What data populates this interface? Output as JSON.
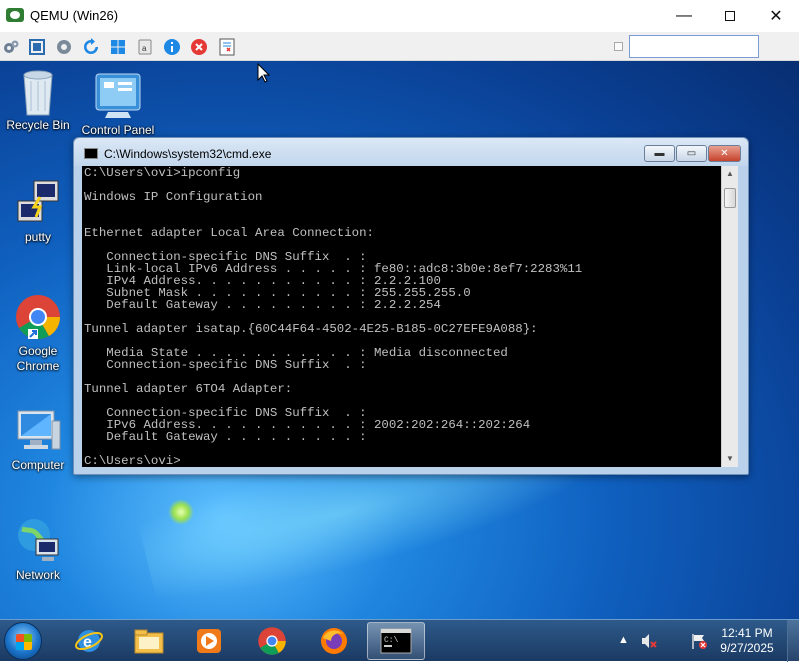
{
  "qemu": {
    "title": "QEMU (Win26)",
    "controls": {
      "minimize": "—",
      "close": "✕"
    },
    "toolbar": {
      "icons": [
        "settings-gears-icon",
        "fullscreen-icon",
        "gear-icon",
        "refresh-icon",
        "windows-icon",
        "usb-drive-icon",
        "info-icon",
        "stop-icon",
        "screenshot-icon"
      ],
      "input_value": ""
    }
  },
  "desktop": {
    "icons": [
      {
        "label": "Recycle Bin",
        "icon": "recycle-bin-icon"
      },
      {
        "label": "Control Panel",
        "icon": "control-panel-icon"
      },
      {
        "label": "putty",
        "icon": "putty-icon"
      },
      {
        "label": "Google Chrome",
        "icon": "chrome-icon"
      },
      {
        "label": "Computer",
        "icon": "computer-icon"
      },
      {
        "label": "Network",
        "icon": "network-icon"
      }
    ]
  },
  "cmd": {
    "title": "C:\\Windows\\system32\\cmd.exe",
    "controls": {
      "minimize": "▬",
      "maximize": "▭",
      "close": "✕"
    },
    "output": "C:\\Users\\ovi>ipconfig\n\nWindows IP Configuration\n\n\nEthernet adapter Local Area Connection:\n\n   Connection-specific DNS Suffix  . :\n   Link-local IPv6 Address . . . . . : fe80::adc8:3b0e:8ef7:2283%11\n   IPv4 Address. . . . . . . . . . . : 2.2.2.100\n   Subnet Mask . . . . . . . . . . . : 255.255.255.0\n   Default Gateway . . . . . . . . . : 2.2.2.254\n\nTunnel adapter isatap.{60C44F64-4502-4E25-B185-0C27EFE9A088}:\n\n   Media State . . . . . . . . . . . : Media disconnected\n   Connection-specific DNS Suffix  . :\n\nTunnel adapter 6TO4 Adapter:\n\n   Connection-specific DNS Suffix  . :\n   IPv6 Address. . . . . . . . . . . : 2002:202:264::202:264\n   Default Gateway . . . . . . . . . :\n\nC:\\Users\\ovi>"
  },
  "taskbar": {
    "pinned": [
      "internet-explorer-icon",
      "file-explorer-icon",
      "media-player-icon",
      "chrome-icon",
      "firefox-icon",
      "cmd-icon"
    ],
    "active": "cmd-icon",
    "tray": {
      "arrow": "▲",
      "icons": [
        "volume-muted-icon",
        "action-center-flag-icon"
      ]
    },
    "clock": {
      "time": "12:41 PM",
      "date": "9/27/2025"
    }
  }
}
